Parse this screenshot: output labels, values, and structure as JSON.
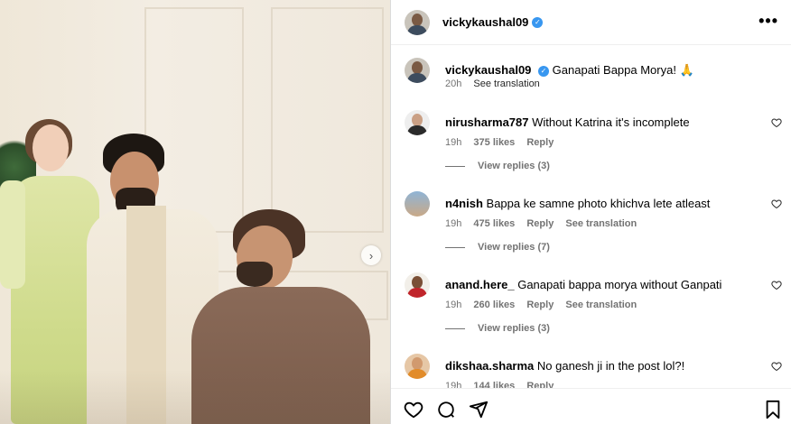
{
  "post": {
    "author": "vickykaushal09",
    "caption": "Ganapati Bappa Morya! 🙏",
    "time": "20h",
    "see_translation": "See translation",
    "more_icon": "•••"
  },
  "comments": [
    {
      "user": "nirusharma787",
      "text": "Without Katrina it's incomplete",
      "time": "19h",
      "likes": "375 likes",
      "reply": "Reply",
      "translate": "",
      "view_replies": "View replies (3)"
    },
    {
      "user": "n4nish",
      "text": "Bappa ke samne photo khichva lete atleast",
      "time": "19h",
      "likes": "475 likes",
      "reply": "Reply",
      "translate": "See translation",
      "view_replies": "View replies (7)"
    },
    {
      "user": "anand.here_",
      "text": "Ganapati bappa morya without Ganpati",
      "time": "19h",
      "likes": "260 likes",
      "reply": "Reply",
      "translate": "See translation",
      "view_replies": "View replies (3)"
    },
    {
      "user": "dikshaa.sharma",
      "text": "No ganesh ji in the post lol?!",
      "time": "19h",
      "likes": "144 likes",
      "reply": "Reply",
      "translate": "",
      "view_replies": ""
    }
  ],
  "icons": {
    "verified": "✓",
    "next": "›",
    "actions": [
      "heart-icon",
      "comment-icon",
      "share-icon",
      "bookmark-icon"
    ]
  }
}
